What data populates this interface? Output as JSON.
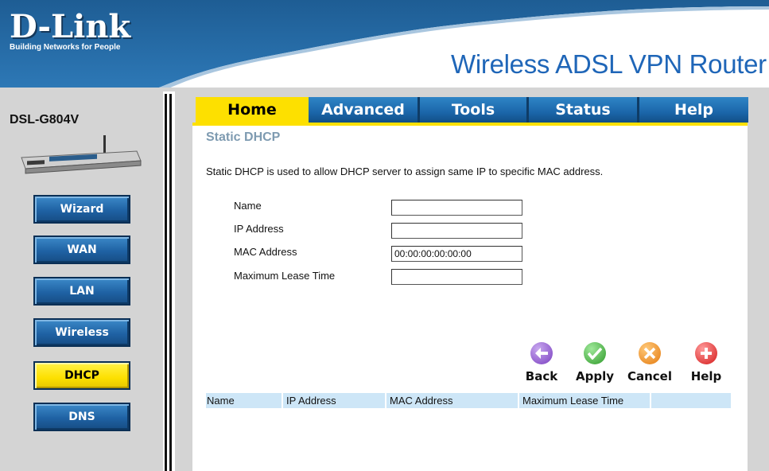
{
  "brand": {
    "logo": "D-Link",
    "tagline": "Building Networks for People",
    "product": "Wireless ADSL VPN Router",
    "model": "DSL-G804V"
  },
  "sidebar": {
    "items": [
      {
        "label": "Wizard",
        "active": false
      },
      {
        "label": "WAN",
        "active": false
      },
      {
        "label": "LAN",
        "active": false
      },
      {
        "label": "Wireless",
        "active": false
      },
      {
        "label": "DHCP",
        "active": true
      },
      {
        "label": "DNS",
        "active": false
      }
    ]
  },
  "tabs": [
    {
      "label": "Home",
      "active": true
    },
    {
      "label": "Advanced",
      "active": false
    },
    {
      "label": "Tools",
      "active": false
    },
    {
      "label": "Status",
      "active": false
    },
    {
      "label": "Help",
      "active": false
    }
  ],
  "page": {
    "title": "Static DHCP",
    "description": "Static DHCP is used to allow DHCP server to assign same IP to specific MAC address."
  },
  "form": {
    "name_label": "Name",
    "name_value": "",
    "ip_label": "IP Address",
    "ip_value": "",
    "mac_label": "MAC Address",
    "mac_value": "00:00:00:00:00:00",
    "lease_label": "Maximum Lease Time",
    "lease_value": ""
  },
  "actions": {
    "back": "Back",
    "apply": "Apply",
    "cancel": "Cancel",
    "help": "Help"
  },
  "table": {
    "columns": [
      "Name",
      "IP Address",
      "MAC Address",
      "Maximum Lease Time"
    ]
  },
  "colors": {
    "accent_yellow": "#fde000",
    "nav_blue": "#1b66aa",
    "product_blue": "#1f66b8",
    "title_gray_blue": "#7e9bb1",
    "table_header": "#cde6f7"
  }
}
